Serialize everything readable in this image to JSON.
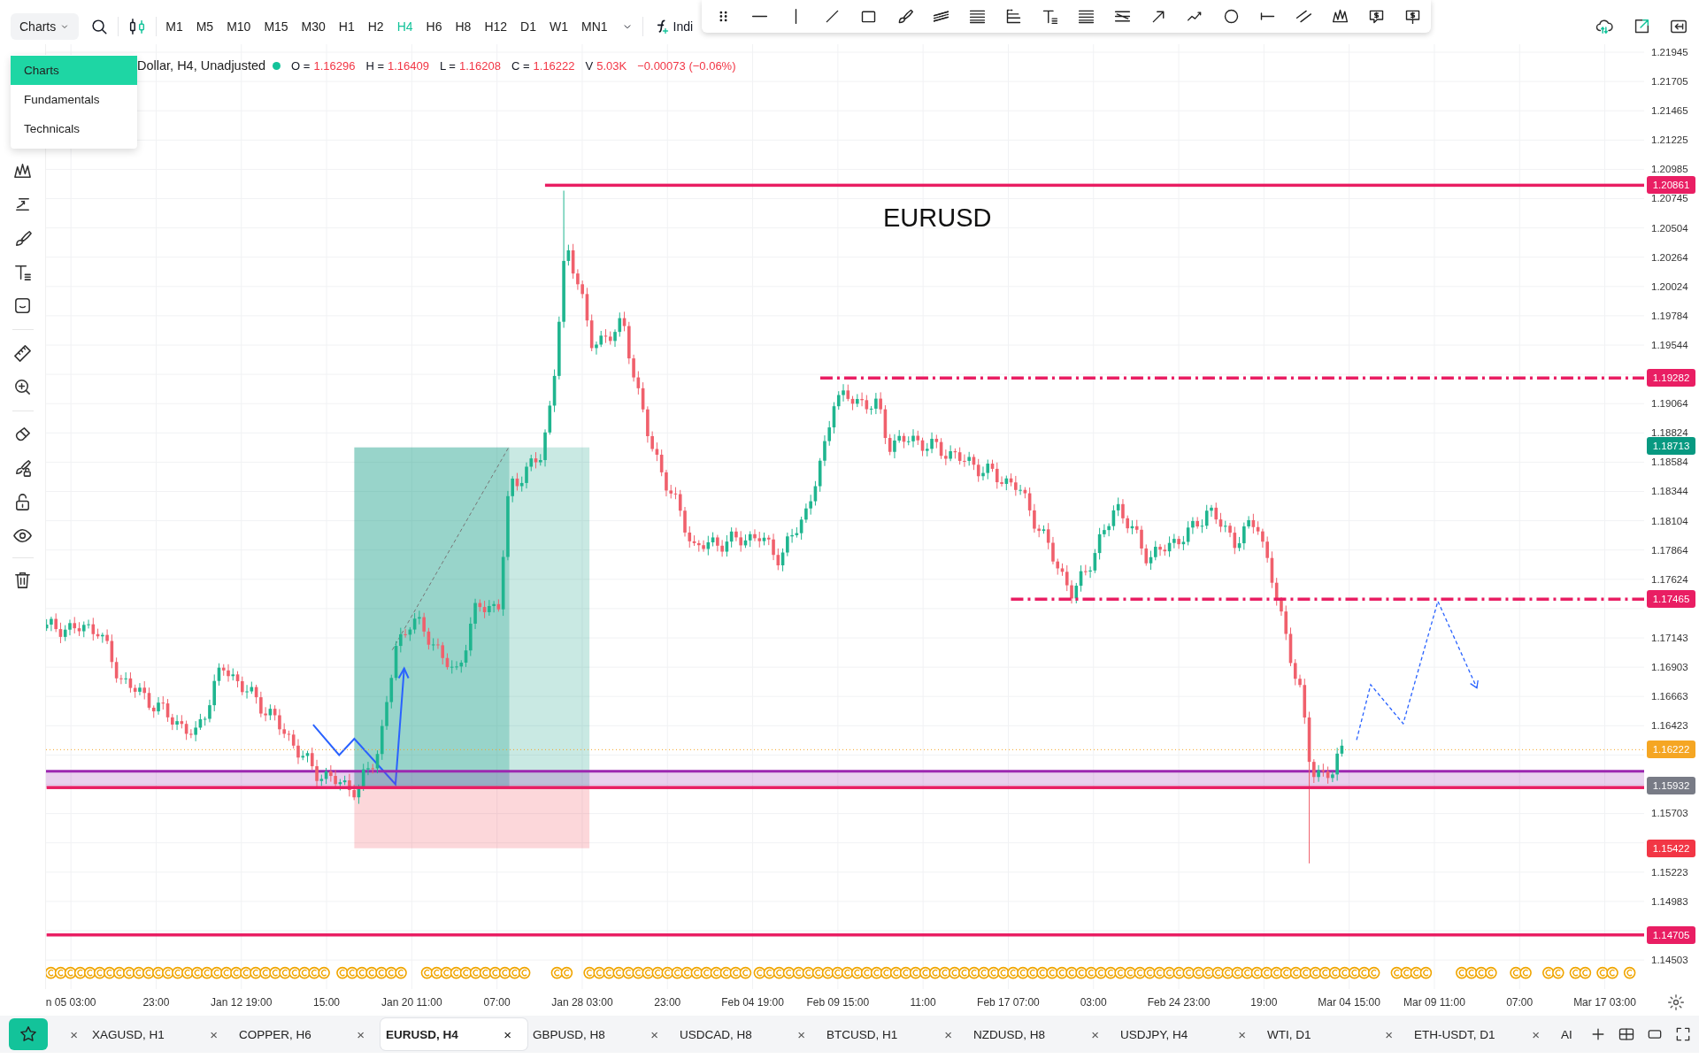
{
  "top_bar": {
    "chart_menu": "Charts",
    "timeframes": [
      {
        "label": "M1",
        "selected": false
      },
      {
        "label": "M5",
        "selected": false
      },
      {
        "label": "M10",
        "selected": false
      },
      {
        "label": "M15",
        "selected": false
      },
      {
        "label": "M30",
        "selected": false
      },
      {
        "label": "H1",
        "selected": false
      },
      {
        "label": "H2",
        "selected": false
      },
      {
        "label": "H4",
        "selected": true
      },
      {
        "label": "H6",
        "selected": false
      },
      {
        "label": "H8",
        "selected": false
      },
      {
        "label": "H12",
        "selected": false
      },
      {
        "label": "D1",
        "selected": false
      },
      {
        "label": "W1",
        "selected": false
      },
      {
        "label": "MN1",
        "selected": false
      }
    ],
    "indicators": "Indi"
  },
  "menu": {
    "items": [
      {
        "label": "Charts",
        "selected": true
      },
      {
        "label": "Fundamentals",
        "selected": false
      },
      {
        "label": "Technicals",
        "selected": false
      }
    ]
  },
  "legend": {
    "title": "Dollar, H4, Unadjusted",
    "values": [
      {
        "label": "O =",
        "value": "1.16296"
      },
      {
        "label": "H =",
        "value": "1.16409"
      },
      {
        "label": "L =",
        "value": "1.16208"
      },
      {
        "label": "C =",
        "value": "1.16222"
      },
      {
        "label": "V",
        "value": "5.03K"
      }
    ],
    "change": "−0.00073 (−0.06%)"
  },
  "chart": {
    "annotation": "EURUSD",
    "levels": [
      {
        "kind": "solid",
        "color": "#e91e63"
      },
      {
        "kind": "dash-dot",
        "color": "#e91e63"
      },
      {
        "kind": "dash-dot",
        "color": "#e91e63"
      },
      {
        "kind": "solid",
        "color": "#e91e63"
      },
      {
        "kind": "solid",
        "color": "#e91e63"
      }
    ]
  },
  "price_axis": {
    "ticks": [
      "1.21945",
      "1.21705",
      "1.21465",
      "1.21225",
      "1.20985",
      "1.20745",
      "1.20504",
      "1.20264",
      "1.20024",
      "1.19784",
      "1.19544",
      "1.19064",
      "1.18824",
      "1.18584",
      "1.18344",
      "1.18104",
      "1.17864",
      "1.17624",
      "1.17143",
      "1.16903",
      "1.16663",
      "1.16423",
      "1.15703",
      "1.15223",
      "1.14983",
      "1.14503"
    ],
    "tags": [
      {
        "text": "1.20861",
        "color": "#e91e63"
      },
      {
        "text": "1.19282",
        "color": "#e91e63"
      },
      {
        "text": "1.18713",
        "color": "#089981"
      },
      {
        "text": "1.17465",
        "color": "#e91e63"
      },
      {
        "text": "1.16222",
        "color": "#f5a623"
      },
      {
        "text": "1.15932",
        "color": "#787b86"
      },
      {
        "text": "1.15422",
        "color": "#f23645"
      },
      {
        "text": "1.14705",
        "color": "#e91e63"
      }
    ]
  },
  "time_axis": {
    "labels": [
      "n 05 03:00",
      "23:00",
      "Jan 12 19:00",
      "15:00",
      "Jan 20 11:00",
      "07:00",
      "Jan 28 03:00",
      "23:00",
      "Feb 04 19:00",
      "Feb 09 15:00",
      "11:00",
      "Feb 17 07:00",
      "03:00",
      "Feb 24 23:00",
      "19:00",
      "Mar 04 15:00",
      "Mar 09 11:00",
      "07:00",
      "Mar 17 03:00"
    ]
  },
  "tabs": [
    {
      "close": "×",
      "selected": false
    },
    {
      "label": "XAGUSD, H1",
      "close": "×",
      "selected": false
    },
    {
      "label": "COPPER, H6",
      "close": "×",
      "selected": false
    },
    {
      "label": "EURUSD, H4",
      "close": "×",
      "selected": true
    },
    {
      "label": "GBPUSD, H8",
      "close": "×",
      "selected": false
    },
    {
      "label": "USDCAD, H8",
      "close": "×",
      "selected": false
    },
    {
      "label": "BTCUSD, H1",
      "close": "×",
      "selected": false
    },
    {
      "label": "NZDUSD, H8",
      "close": "×",
      "selected": false
    },
    {
      "label": "USDJPY, H4",
      "close": "×",
      "selected": false
    },
    {
      "label": "WTI, D1",
      "close": "×",
      "selected": false
    },
    {
      "label": "ETH-USDT, D1",
      "close": "×",
      "selected": false
    },
    {
      "label": "AI",
      "selected": false
    }
  ]
}
